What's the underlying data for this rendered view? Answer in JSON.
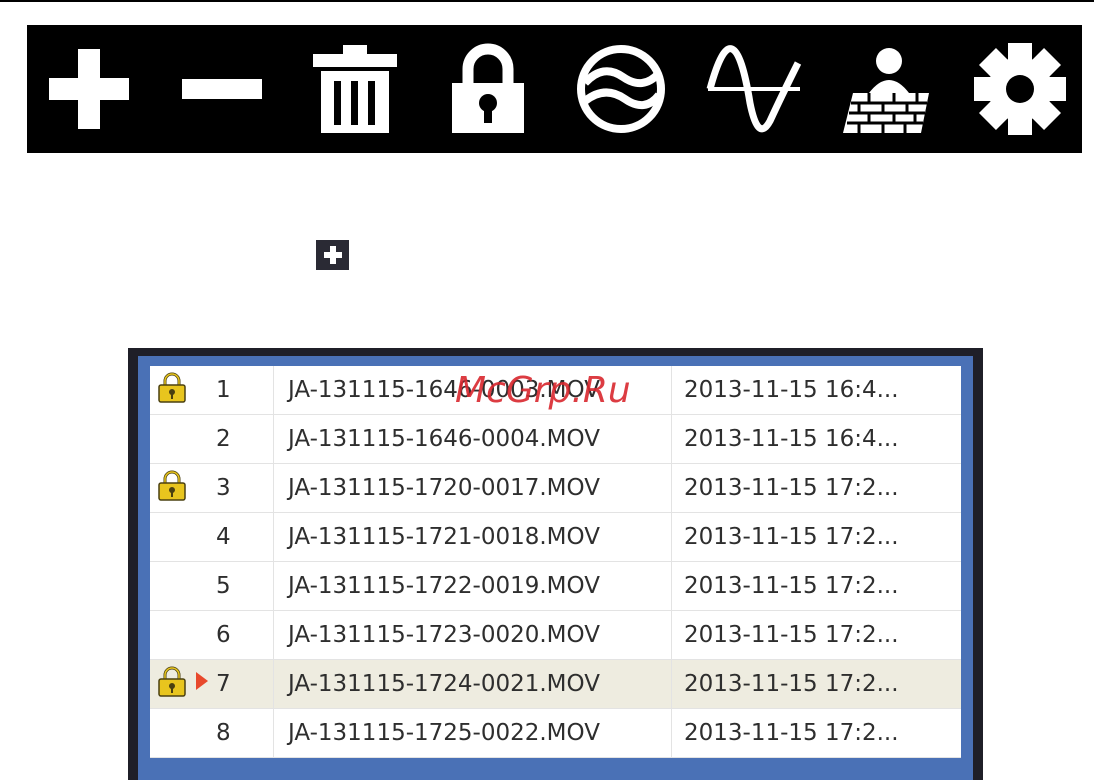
{
  "toolbar": {
    "icons": [
      "add-icon",
      "remove-icon",
      "delete-icon",
      "lock-icon",
      "globe-icon",
      "waveform-icon",
      "firewall-icon",
      "gear-icon"
    ],
    "icon_color": "#ffffff",
    "background": "#000000"
  },
  "expand_icon": "plus-icon",
  "files": {
    "rows": [
      {
        "locked": true,
        "selected": false,
        "num": "1",
        "name": "JA-131115-1646-0003.MOV",
        "date": "2013-11-15 16:4..."
      },
      {
        "locked": false,
        "selected": false,
        "num": "2",
        "name": "JA-131115-1646-0004.MOV",
        "date": "2013-11-15 16:4..."
      },
      {
        "locked": true,
        "selected": false,
        "num": "3",
        "name": "JA-131115-1720-0017.MOV",
        "date": "2013-11-15 17:2..."
      },
      {
        "locked": false,
        "selected": false,
        "num": "4",
        "name": "JA-131115-1721-0018.MOV",
        "date": "2013-11-15 17:2..."
      },
      {
        "locked": false,
        "selected": false,
        "num": "5",
        "name": "JA-131115-1722-0019.MOV",
        "date": "2013-11-15 17:2..."
      },
      {
        "locked": false,
        "selected": false,
        "num": "6",
        "name": "JA-131115-1723-0020.MOV",
        "date": "2013-11-15 17:2..."
      },
      {
        "locked": true,
        "selected": true,
        "num": "7",
        "name": "JA-131115-1724-0021.MOV",
        "date": "2013-11-15 17:2..."
      },
      {
        "locked": false,
        "selected": false,
        "num": "8",
        "name": "JA-131115-1725-0022.MOV",
        "date": "2013-11-15 17:2..."
      }
    ],
    "lock_color": "#e8c51e",
    "marker_color": "#e8492c",
    "selected_row_color": "#eeece0",
    "frame_color": "#4a71b6"
  },
  "watermark": "McGrp.Ru"
}
